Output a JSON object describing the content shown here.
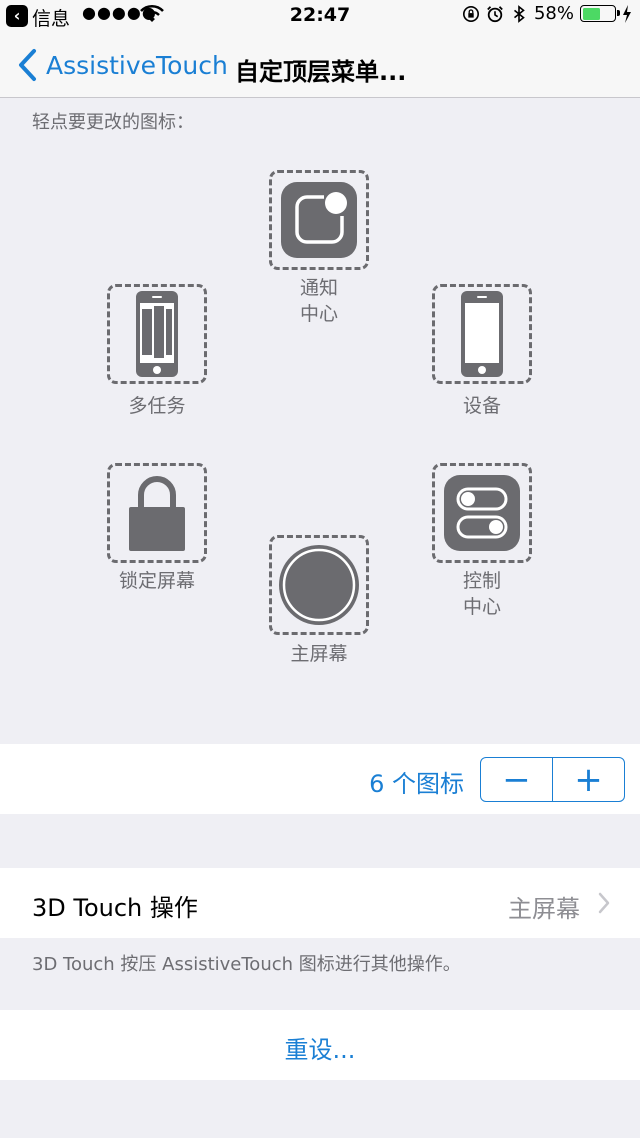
{
  "status_bar": {
    "back_app": "信息",
    "signal": "●●●●●",
    "time": "22:47",
    "battery_percent": "58%",
    "battery_level": 0.58,
    "icons": [
      "wifi-icon",
      "rotation-lock-icon",
      "alarm-icon",
      "bluetooth-icon",
      "battery-icon",
      "charging-icon"
    ]
  },
  "nav": {
    "back_label": "AssistiveTouch",
    "title": "自定顶层菜单..."
  },
  "prompt": "轻点要更改的图标：",
  "icon_slots": [
    {
      "label_line1": "通知",
      "label_line2": "中心",
      "icon": "notification-center-icon"
    },
    {
      "label_line1": "多任务",
      "label_line2": "",
      "icon": "multitasking-icon"
    },
    {
      "label_line1": "设备",
      "label_line2": "",
      "icon": "device-icon"
    },
    {
      "label_line1": "锁定屏幕",
      "label_line2": "",
      "icon": "lock-screen-icon"
    },
    {
      "label_line1": "控制",
      "label_line2": "中心",
      "icon": "control-center-icon"
    },
    {
      "label_line1": "主屏幕",
      "label_line2": "",
      "icon": "home-button-icon"
    }
  ],
  "count": {
    "text": "6 个图标",
    "minus": "−",
    "plus": "+"
  },
  "touch": {
    "title": "3D Touch 操作",
    "value": "主屏幕",
    "footer": "3D Touch 按压 AssistiveTouch 图标进行其他操作。"
  },
  "reset": {
    "label": "重设..."
  },
  "colors": {
    "accent": "#1a7fd4",
    "icon_gray": "#6b6b6f",
    "background": "#efeff4",
    "battery_green": "#4cd964"
  }
}
